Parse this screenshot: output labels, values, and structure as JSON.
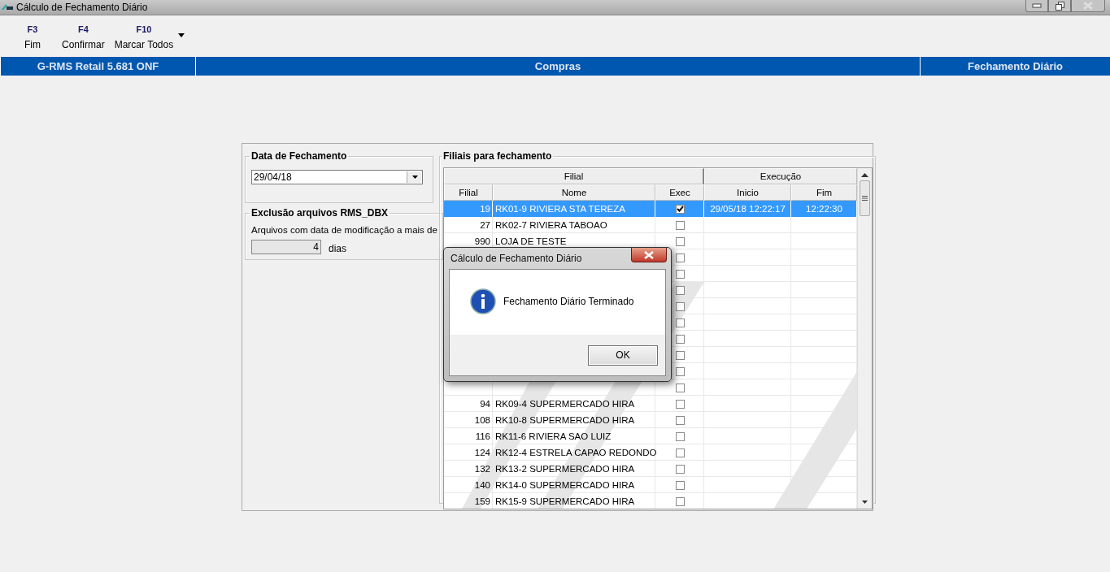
{
  "window": {
    "title": "Cálculo de Fechamento Diário"
  },
  "toolbar": [
    {
      "key": "F3",
      "label": "Fim"
    },
    {
      "key": "F4",
      "label": "Confirmar"
    },
    {
      "key": "F10",
      "label": "Marcar Todos"
    }
  ],
  "info_bar": [
    "G-RMS Retail 5.681 ONF",
    "Compras",
    "Fechamento Diário"
  ],
  "date_group": {
    "title": "Data de Fechamento",
    "value": "29/04/18"
  },
  "cleanup_group": {
    "title": "Exclusão arquivos RMS_DBX",
    "text": "Arquivos com data de modificação a mais de",
    "days": "4",
    "unit": "dias"
  },
  "grid": {
    "title": "Filiais para fechamento",
    "group_headers": [
      "Filial",
      "Execução"
    ],
    "columns": [
      "Filial",
      "Nome",
      "Exec",
      "Inicio",
      "Fim"
    ],
    "rows": [
      {
        "filial": "19",
        "nome": "RK01-9 RIVIERA STA TEREZA",
        "exec": true,
        "inicio": "29/05/18 12:22:17",
        "fim": "12:22:30",
        "selected": true
      },
      {
        "filial": "27",
        "nome": "RK02-7 RIVIERA TABOAO",
        "exec": false,
        "selected": false
      },
      {
        "filial": "990",
        "nome": "LOJA DE TESTE",
        "exec": false,
        "selected": false
      },
      {
        "exec": false,
        "selected": false
      },
      {
        "exec": false,
        "selected": false
      },
      {
        "exec": false,
        "selected": false
      },
      {
        "exec": false,
        "selected": false
      },
      {
        "exec": false,
        "selected": false
      },
      {
        "exec": false,
        "selected": false
      },
      {
        "exec": false,
        "selected": false
      },
      {
        "exec": false,
        "selected": false
      },
      {
        "exec": false,
        "selected": false
      },
      {
        "filial": "94",
        "nome": "RK09-4 SUPERMERCADO HIRA",
        "exec": false,
        "selected": false
      },
      {
        "filial": "108",
        "nome": "RK10-8 SUPERMERCADO HIRA",
        "exec": false,
        "selected": false
      },
      {
        "filial": "116",
        "nome": "RK11-6 RIVIERA SAO LUIZ",
        "exec": false,
        "selected": false
      },
      {
        "filial": "124",
        "nome": "RK12-4 ESTRELA CAPAO REDONDO",
        "exec": false,
        "selected": false
      },
      {
        "filial": "132",
        "nome": "RK13-2 SUPERMERCADO HIRA",
        "exec": false,
        "selected": false
      },
      {
        "filial": "140",
        "nome": "RK14-0 SUPERMERCADO HIRA",
        "exec": false,
        "selected": false
      },
      {
        "filial": "159",
        "nome": "RK15-9 SUPERMERCADO HIRA",
        "exec": false,
        "selected": false
      }
    ]
  },
  "dialog": {
    "title": "Cálculo de Fechamento Diário",
    "message": "Fechamento Diário Terminado",
    "button": "OK"
  }
}
